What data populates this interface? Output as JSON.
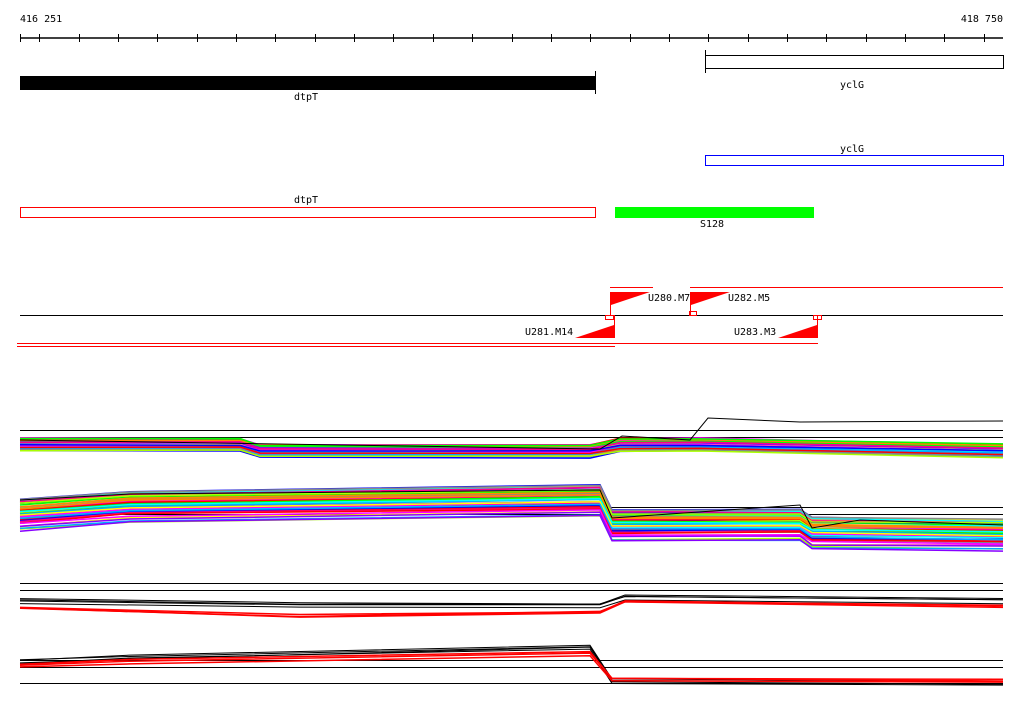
{
  "ruler": {
    "start": "416 251",
    "end": "418 750"
  },
  "genes": [
    {
      "name": "dtpT",
      "strand_track": "top",
      "color": "#000000"
    },
    {
      "name": "yclG",
      "strand_track": "top",
      "color": "#000000"
    },
    {
      "name": "yclG",
      "track": "annotation",
      "color": "#0000ff"
    },
    {
      "name": "dtpT",
      "track": "annotation",
      "color": "#ff0000"
    },
    {
      "name": "S128",
      "track": "segment",
      "color": "#00ff00"
    }
  ],
  "transcripts": [
    {
      "name": "U280.M7"
    },
    {
      "name": "U282.M5"
    },
    {
      "name": "U281.M14"
    },
    {
      "name": "U283.M3"
    }
  ],
  "colors": {
    "accent_red": "#ff0000",
    "accent_green": "#00ff00",
    "accent_blue": "#0000ff"
  }
}
